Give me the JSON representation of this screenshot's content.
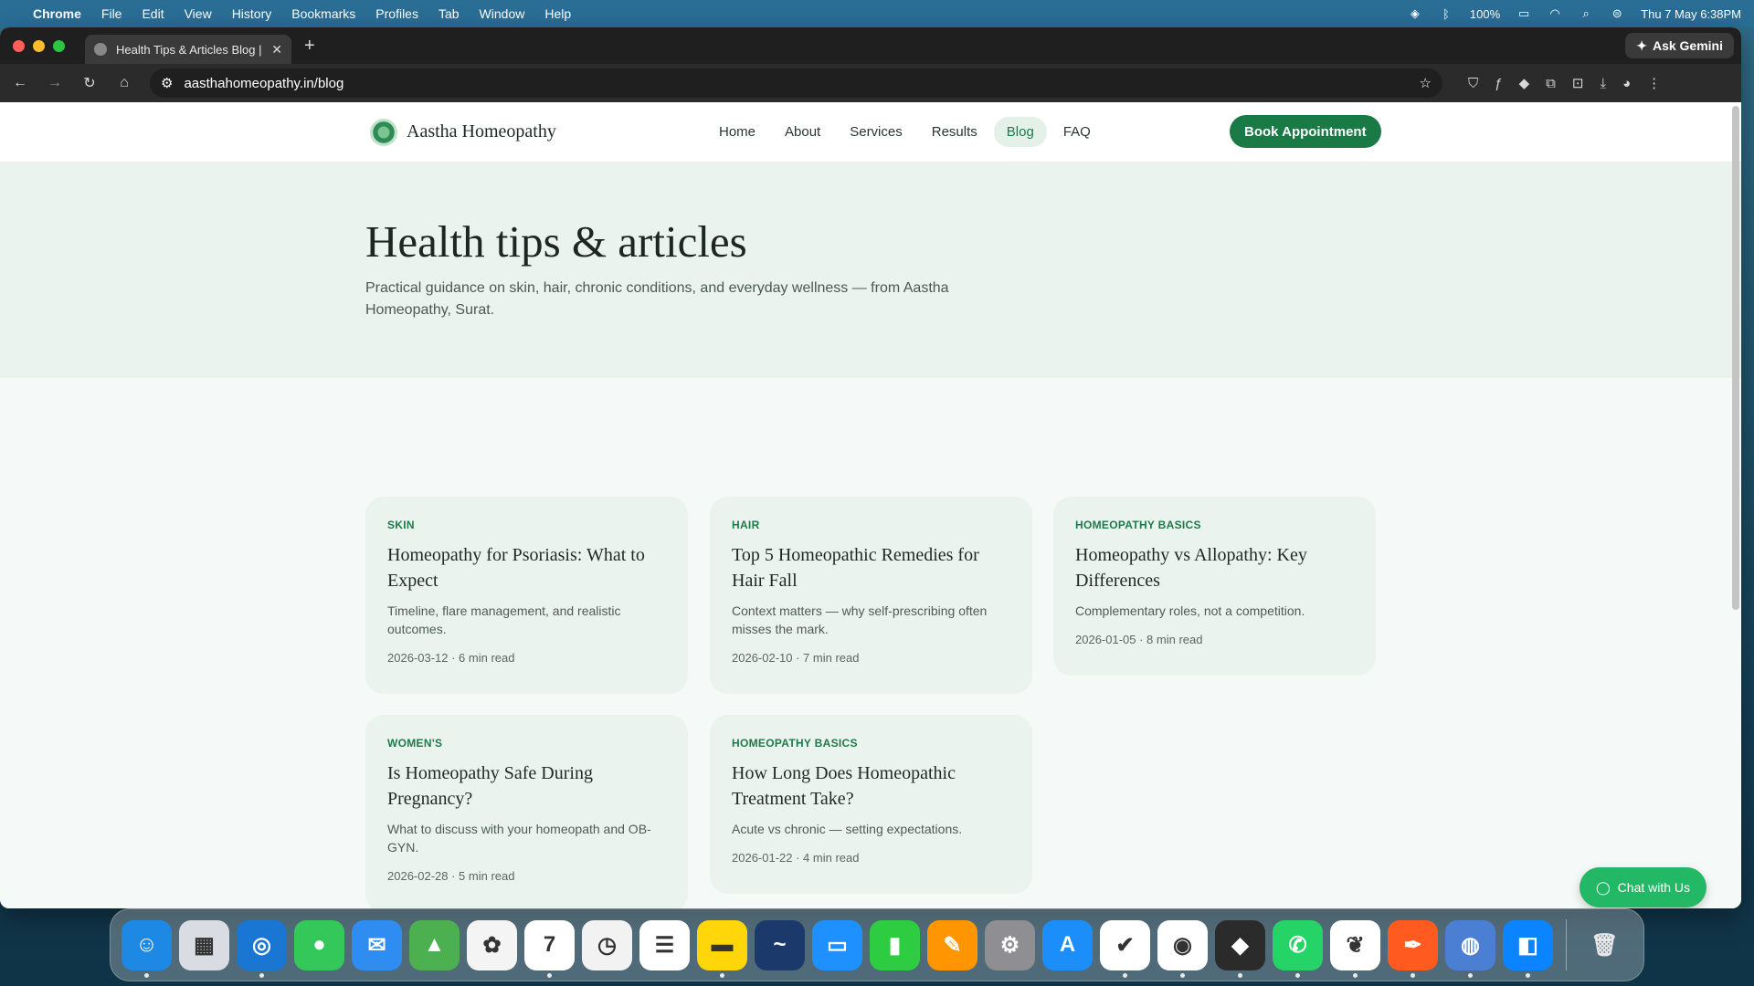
{
  "menubar": {
    "app_name": "Chrome",
    "menus": [
      "File",
      "Edit",
      "View",
      "History",
      "Bookmarks",
      "Profiles",
      "Tab",
      "Window",
      "Help"
    ],
    "battery": "100%",
    "datetime": "Thu 7 May  6:38PM"
  },
  "browser": {
    "tab_title": "Health Tips & Articles Blog | A",
    "url": "aasthahomeopathy.in/blog",
    "gemini_label": "Ask Gemini"
  },
  "site": {
    "brand": "Aastha Homeopathy",
    "nav": [
      "Home",
      "About",
      "Services",
      "Results",
      "Blog",
      "FAQ"
    ],
    "active_nav": "Blog",
    "cta": "Book Appointment",
    "hero_title": "Health tips & articles",
    "hero_subtitle": "Practical guidance on skin, hair, chronic conditions, and everyday wellness — from Aastha Homeopathy, Surat.",
    "chat_label": "Chat with Us"
  },
  "articles": [
    {
      "category": "SKIN",
      "title": "Homeopathy for Psoriasis: What to Expect",
      "excerpt": "Timeline, flare management, and realistic outcomes.",
      "meta": "2026-03-12 · 6 min read"
    },
    {
      "category": "HAIR",
      "title": "Top 5 Homeopathic Remedies for Hair Fall",
      "excerpt": "Context matters — why self-prescribing often misses the mark.",
      "meta": "2026-02-10 · 7 min read"
    },
    {
      "category": "HOMEOPATHY BASICS",
      "title": "Homeopathy vs Allopathy: Key Differences",
      "excerpt": "Complementary roles, not a competition.",
      "meta": "2026-01-05 · 8 min read"
    },
    {
      "category": "WOMEN'S",
      "title": "Is Homeopathy Safe During Pregnancy?",
      "excerpt": "What to discuss with your homeopath and OB-GYN.",
      "meta": "2026-02-28 · 5 min read"
    },
    {
      "category": "HOMEOPATHY BASICS",
      "title": "How Long Does Homeopathic Treatment Take?",
      "excerpt": "Acute vs chronic — setting expectations.",
      "meta": "2026-01-22 · 4 min read"
    }
  ],
  "dock_apps": [
    {
      "name": "finder",
      "color": "#1e88e5",
      "glyph": "☺",
      "running": true
    },
    {
      "name": "launchpad",
      "color": "#d9dde3",
      "glyph": "▦",
      "running": false
    },
    {
      "name": "safari",
      "color": "#1976d2",
      "glyph": "◎",
      "running": true
    },
    {
      "name": "messages",
      "color": "#34c759",
      "glyph": "●",
      "running": false
    },
    {
      "name": "mail",
      "color": "#2f8cf0",
      "glyph": "✉",
      "running": false
    },
    {
      "name": "maps",
      "color": "#4caf50",
      "glyph": "▲",
      "running": false
    },
    {
      "name": "photos",
      "color": "#f4f4f4",
      "glyph": "✿",
      "running": false
    },
    {
      "name": "calendar",
      "color": "#ffffff",
      "glyph": "7",
      "running": true
    },
    {
      "name": "clock",
      "color": "#f2f2f2",
      "glyph": "◷",
      "running": false
    },
    {
      "name": "reminders",
      "color": "#ffffff",
      "glyph": "☰",
      "running": false
    },
    {
      "name": "notes",
      "color": "#ffd60a",
      "glyph": "▬",
      "running": true
    },
    {
      "name": "freeform",
      "color": "#1b3a6b",
      "glyph": "~",
      "running": false
    },
    {
      "name": "keynote",
      "color": "#1e90ff",
      "glyph": "▭",
      "running": false
    },
    {
      "name": "numbers",
      "color": "#2ecc40",
      "glyph": "▮",
      "running": false
    },
    {
      "name": "pages",
      "color": "#ff9500",
      "glyph": "✎",
      "running": false
    },
    {
      "name": "system-settings",
      "color": "#8e8e93",
      "glyph": "⚙",
      "running": false
    },
    {
      "name": "app-store",
      "color": "#1c8ef9",
      "glyph": "A",
      "running": false
    },
    {
      "name": "tasks",
      "color": "#ffffff",
      "glyph": "✔",
      "running": true
    },
    {
      "name": "chrome",
      "color": "#ffffff",
      "glyph": "◉",
      "running": true
    },
    {
      "name": "cursor",
      "color": "#2b2b2b",
      "glyph": "◆",
      "running": true
    },
    {
      "name": "whatsapp",
      "color": "#25d366",
      "glyph": "✆",
      "running": true
    },
    {
      "name": "mongodb",
      "color": "#ffffff",
      "glyph": "❦",
      "running": true
    },
    {
      "name": "pen-app",
      "color": "#ff5a1f",
      "glyph": "✒",
      "running": true
    },
    {
      "name": "disk-utility",
      "color": "#4a7fd4",
      "glyph": "◍",
      "running": true
    },
    {
      "name": "windows-app",
      "color": "#0a84ff",
      "glyph": "◧",
      "running": true
    }
  ],
  "colors": {
    "brand_green": "#197a45",
    "chat_green": "#22b865",
    "hero_bg": "#ebf3ee"
  }
}
